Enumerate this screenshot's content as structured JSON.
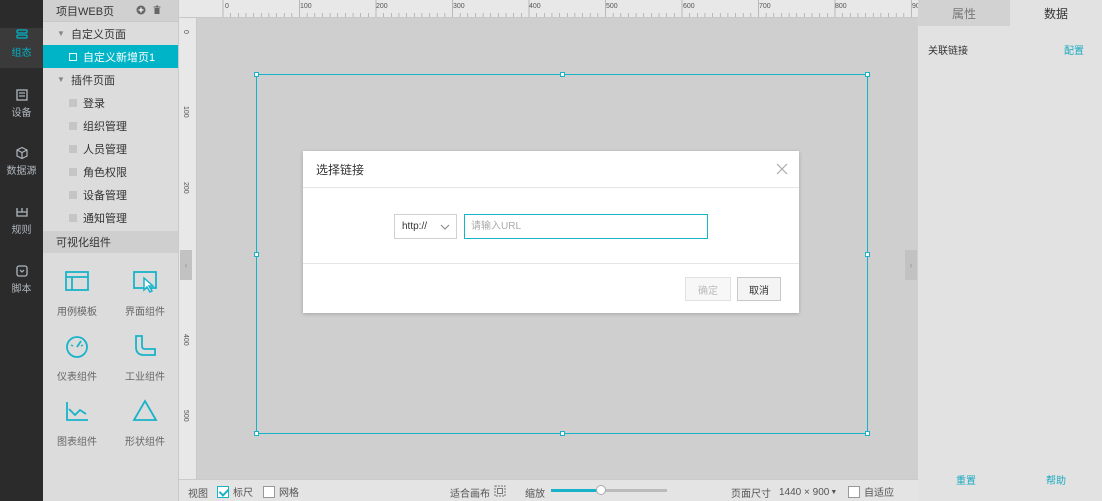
{
  "rail": {
    "items": [
      {
        "label": "组态",
        "icon": "layers-icon",
        "active": true
      },
      {
        "label": "设备",
        "icon": "device-icon",
        "active": false
      },
      {
        "label": "数据源",
        "icon": "cube-icon",
        "active": false
      },
      {
        "label": "规则",
        "icon": "rule-icon",
        "active": false
      },
      {
        "label": "脚本",
        "icon": "script-icon",
        "active": false
      }
    ]
  },
  "panel": {
    "title": "项目WEB页",
    "custom_pages_label": "自定义页面",
    "custom_pages": [
      {
        "label": "自定义新增页1",
        "selected": true
      }
    ],
    "plugin_pages_label": "插件页面",
    "plugin_pages": [
      {
        "label": "登录"
      },
      {
        "label": "组织管理"
      },
      {
        "label": "人员管理"
      },
      {
        "label": "角色权限"
      },
      {
        "label": "设备管理"
      },
      {
        "label": "通知管理"
      }
    ],
    "widgets_label": "可视化组件",
    "widgets": [
      {
        "label": "用例模板",
        "icon": "template-icon"
      },
      {
        "label": "界面组件",
        "icon": "interface-component-icon"
      },
      {
        "label": "仪表组件",
        "icon": "gauge-icon"
      },
      {
        "label": "工业组件",
        "icon": "pipe-icon"
      },
      {
        "label": "图表组件",
        "icon": "chart-icon"
      },
      {
        "label": "形状组件",
        "icon": "triangle-icon"
      }
    ]
  },
  "ruler": {
    "top_labels": [
      "0",
      "100",
      "200",
      "300",
      "400",
      "500",
      "600",
      "700",
      "800",
      "90"
    ],
    "left_labels": [
      "0",
      "100",
      "200",
      "300",
      "400",
      "500"
    ]
  },
  "modal": {
    "title": "选择链接",
    "protocol": "http://",
    "url_value": "",
    "url_placeholder": "请输入URL",
    "ok_label": "确定",
    "cancel_label": "取消"
  },
  "bottom": {
    "view_label": "视图",
    "ruler_label": "标尺",
    "ruler_checked": true,
    "grid_label": "网格",
    "grid_checked": false,
    "fit_label": "适合画布",
    "zoom_label": "缩放",
    "zoom_fraction": 0.43,
    "page_size_label": "页面尺寸",
    "page_size_value": "1440 × 900",
    "auto_fit_label": "自适应",
    "auto_fit_checked": false
  },
  "right": {
    "tabs": [
      {
        "label": "属性",
        "active": false
      },
      {
        "label": "数据",
        "active": true
      }
    ],
    "link_label": "关联链接",
    "config_label": "配置",
    "reset_label": "重置",
    "help_label": "帮助"
  },
  "colors": {
    "accent": "#19b3c9",
    "rail": "#2b2b2b"
  }
}
